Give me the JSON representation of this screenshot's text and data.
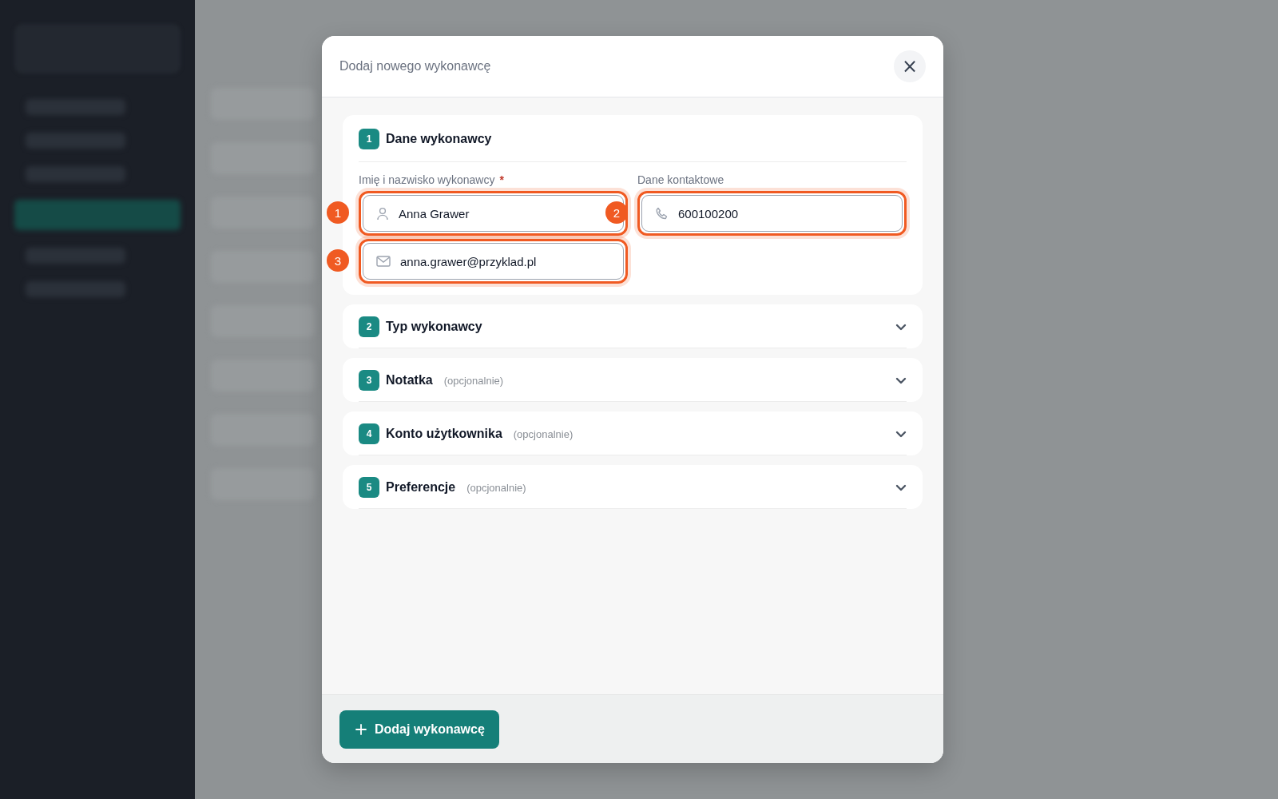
{
  "dialog": {
    "title": "Dodaj nowego wykonawcę",
    "close": "×"
  },
  "sections": [
    {
      "number": "1",
      "title": "Dane wykonawcy",
      "expanded": true,
      "groups": [
        {
          "label": "Imię i nazwisko wykonawcy",
          "required_mark": "*",
          "fields": [
            {
              "kind": "person",
              "value": "Anna Grawer",
              "marker": "1"
            },
            {
              "kind": "mail",
              "value": "anna.grawer@przyklad.pl",
              "marker": "3"
            }
          ]
        },
        {
          "label": "Dane kontaktowe",
          "fields": [
            {
              "kind": "phone",
              "value": "600100200",
              "marker": "2"
            }
          ]
        }
      ]
    },
    {
      "number": "2",
      "title": "Typ wykonawcy",
      "expanded": false
    },
    {
      "number": "3",
      "title": "Notatka",
      "note": "(opcjonalnie)",
      "expanded": false
    },
    {
      "number": "4",
      "title": "Konto użytkownika",
      "note": "(opcjonalnie)",
      "expanded": false
    },
    {
      "number": "5",
      "title": "Preferencje",
      "note": "(opcjonalnie)",
      "expanded": false
    }
  ],
  "submit": {
    "label": "Dodaj wykonawcę"
  }
}
